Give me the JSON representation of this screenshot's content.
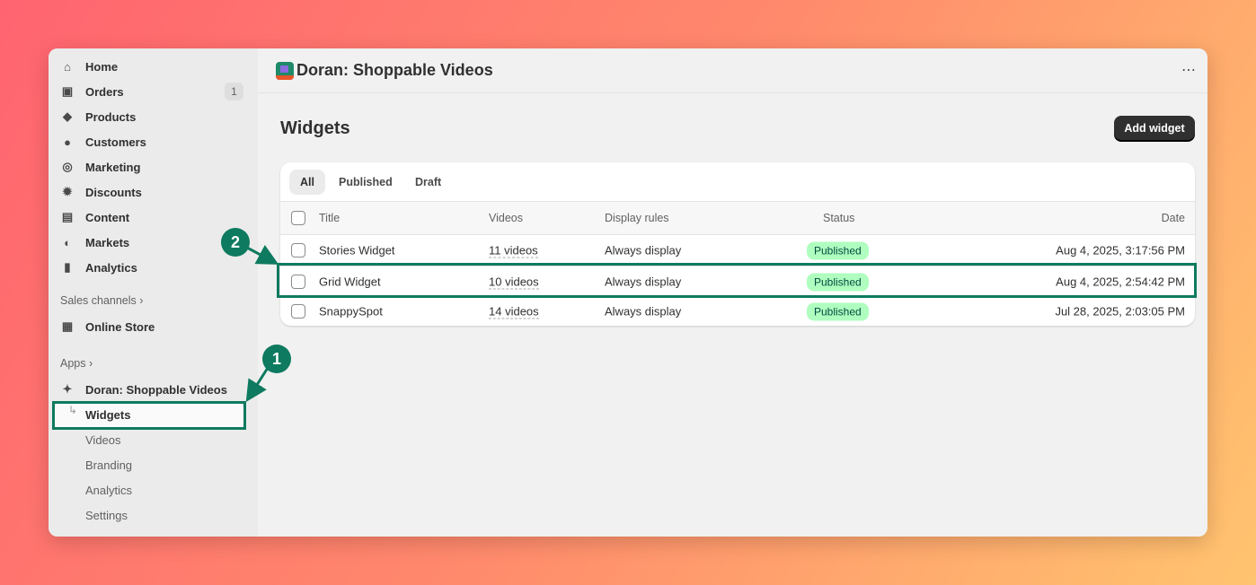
{
  "sidebar": {
    "items": [
      {
        "label": "Home",
        "icon": "home-icon"
      },
      {
        "label": "Orders",
        "icon": "inbox-icon",
        "badge": "1"
      },
      {
        "label": "Products",
        "icon": "tag-icon"
      },
      {
        "label": "Customers",
        "icon": "person-icon"
      },
      {
        "label": "Marketing",
        "icon": "target-icon"
      },
      {
        "label": "Discounts",
        "icon": "discount-icon"
      },
      {
        "label": "Content",
        "icon": "content-icon"
      },
      {
        "label": "Markets",
        "icon": "globe-icon"
      },
      {
        "label": "Analytics",
        "icon": "bar-chart-icon"
      }
    ],
    "sales_channels": "Sales channels",
    "online_store": "Online Store",
    "apps": "Apps",
    "app_name": "Doran: Shoppable Videos",
    "sub_items": [
      "Widgets",
      "Videos",
      "Branding",
      "Analytics",
      "Settings"
    ]
  },
  "header": {
    "title": "Doran: Shoppable Videos",
    "more": "⋯"
  },
  "page": {
    "title": "Widgets",
    "add_button": "Add widget"
  },
  "tabs": [
    "All",
    "Published",
    "Draft"
  ],
  "table": {
    "columns": [
      "Title",
      "Videos",
      "Display rules",
      "Status",
      "Date"
    ],
    "rows": [
      {
        "title": "Stories Widget",
        "videos": "11 videos",
        "rules": "Always display",
        "status": "Published",
        "date": "Aug 4, 2025, 3:17:56 PM"
      },
      {
        "title": "Grid Widget",
        "videos": "10 videos",
        "rules": "Always display",
        "status": "Published",
        "date": "Aug 4, 2025, 2:54:42 PM"
      },
      {
        "title": "SnappySpot",
        "videos": "14 videos",
        "rules": "Always display",
        "status": "Published",
        "date": "Jul 28, 2025, 2:03:05 PM"
      }
    ]
  },
  "annotations": [
    "1",
    "2"
  ],
  "colors": {
    "accent": "#0e7a5f",
    "badge": "#affebf"
  }
}
